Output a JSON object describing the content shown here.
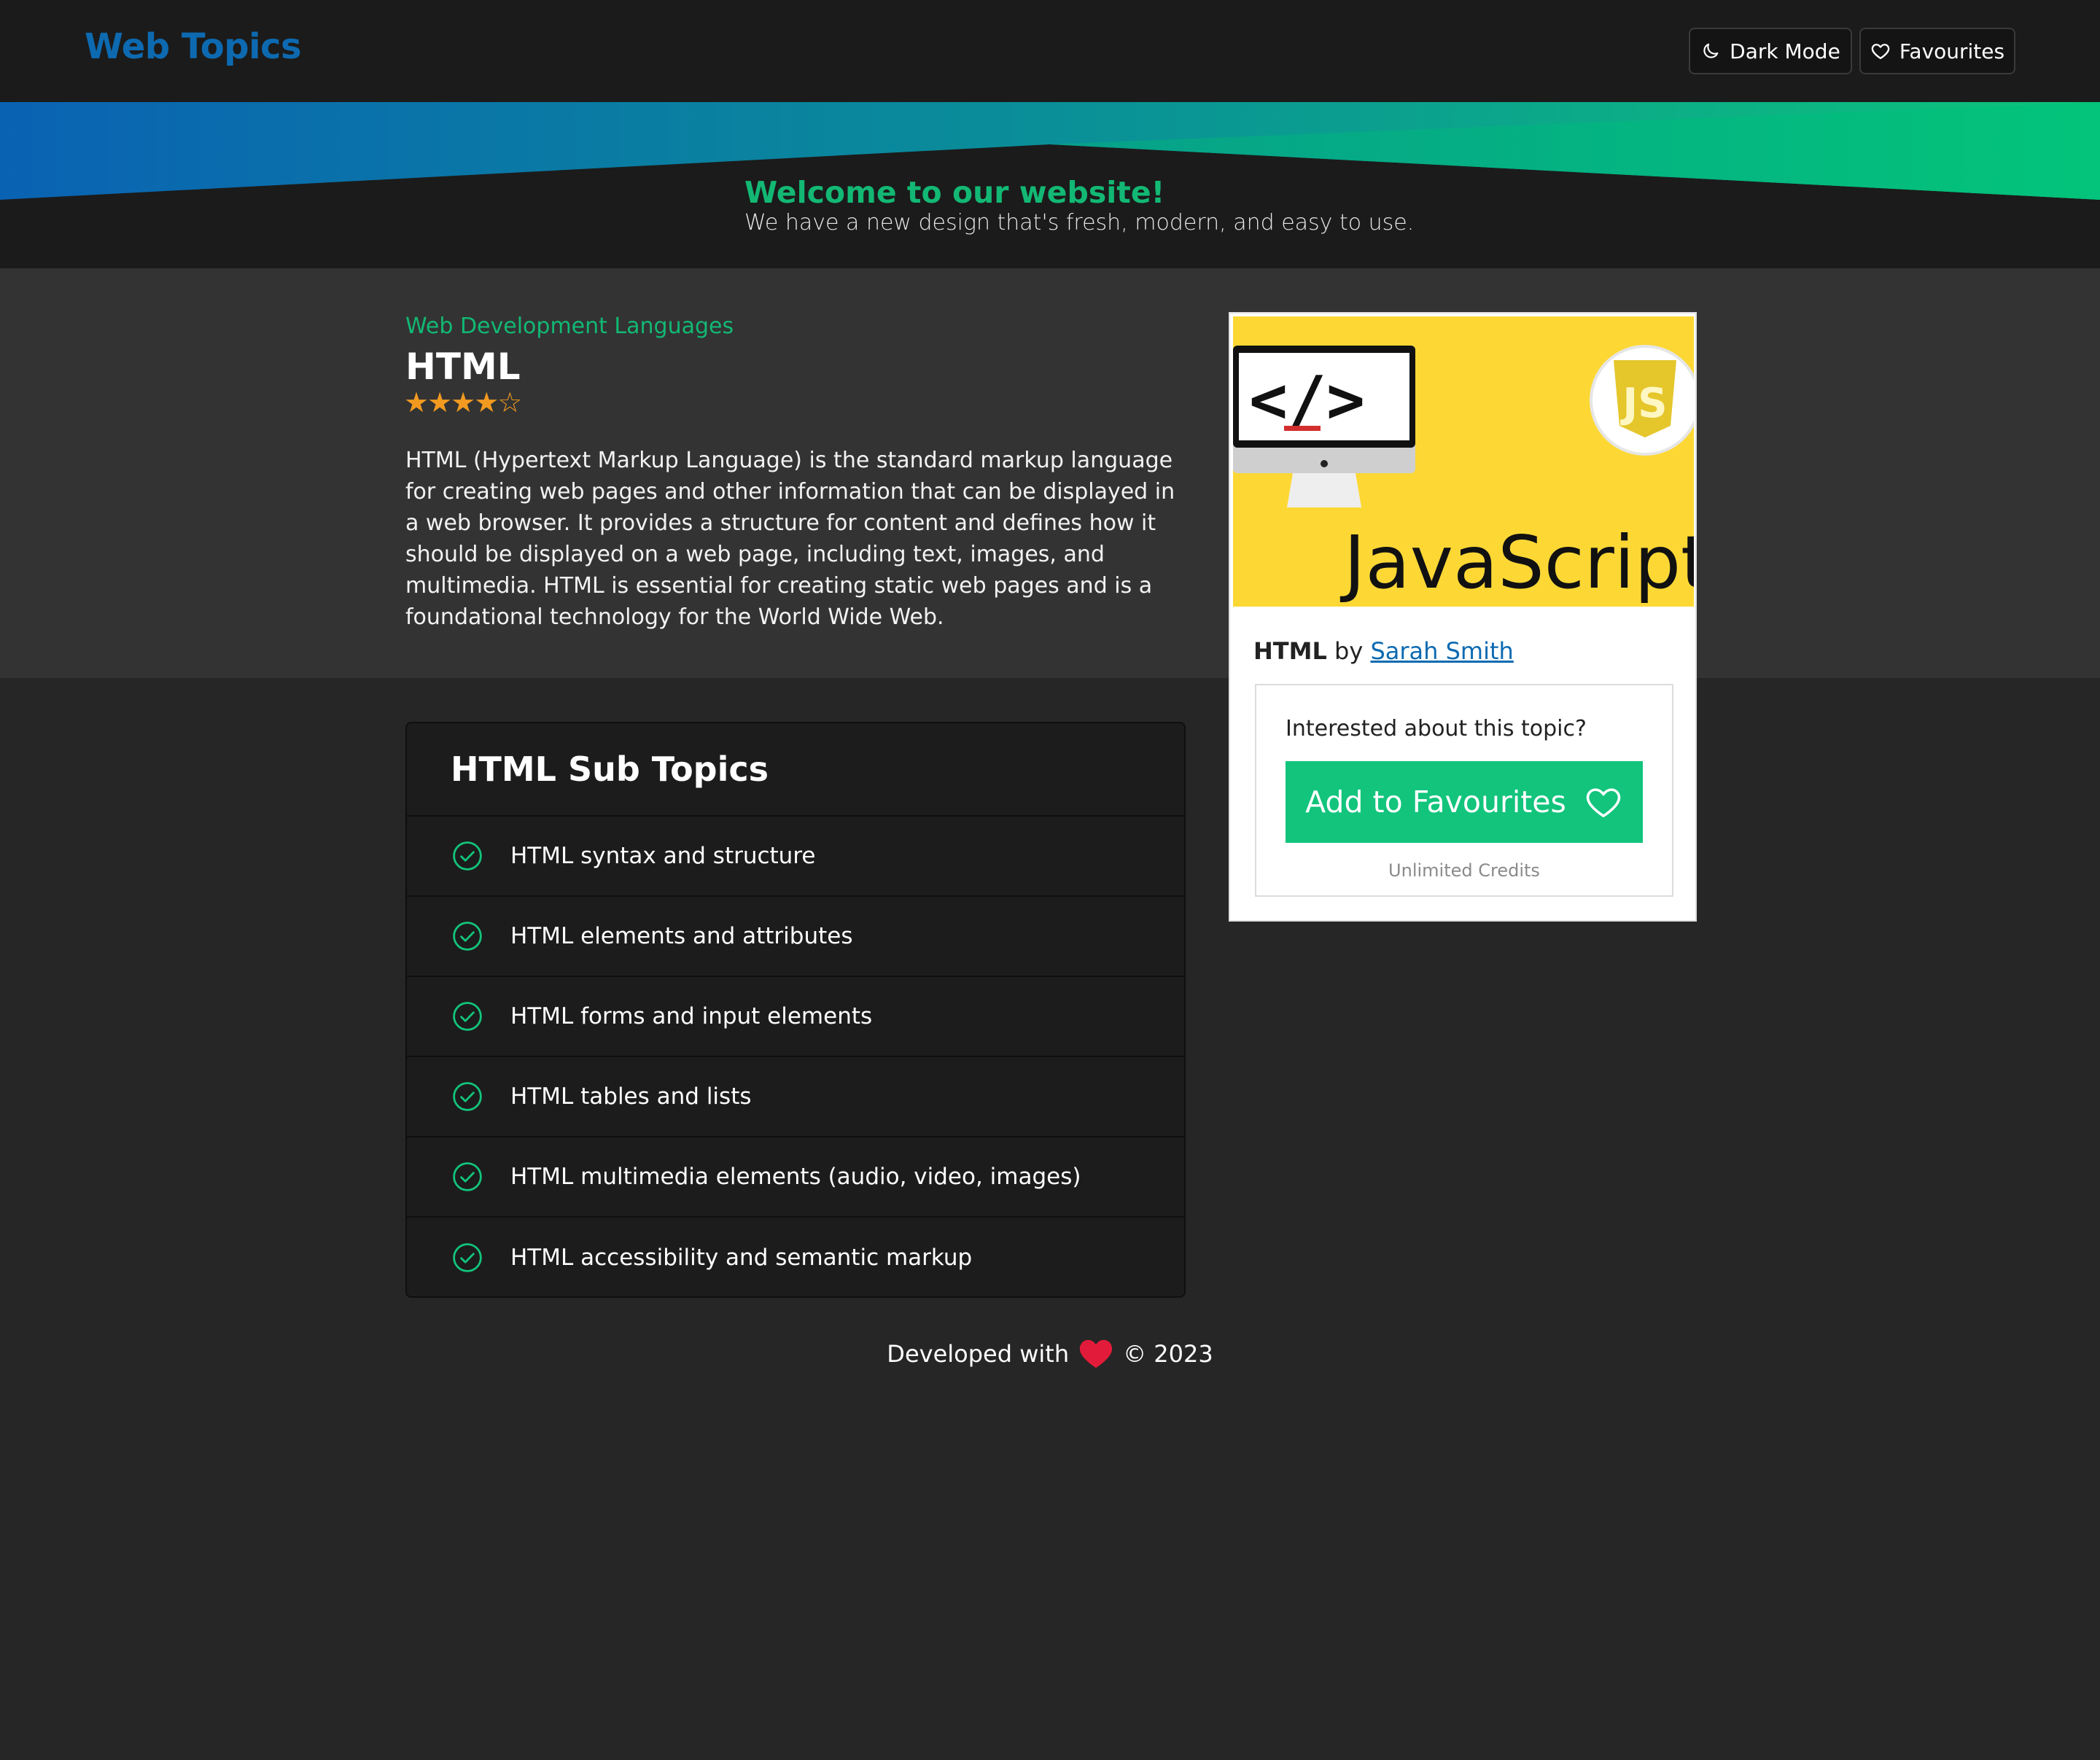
{
  "header": {
    "brand": "Web Topics",
    "dark_mode_label": "Dark Mode",
    "favourites_label": "Favourites"
  },
  "banner": {
    "title": "Welcome to our website!",
    "subtitle": "We have a new design that's fresh, modern, and easy to use."
  },
  "topic": {
    "category": "Web Development Languages",
    "title": "HTML",
    "rating": 4,
    "rating_max": 5,
    "stars_text": "★★★★☆",
    "description": "HTML (Hypertext Markup Language) is the standard markup language for creating web pages and other information that can be displayed in a web browser. It provides a structure for content and defines how it should be displayed on a web page, including text, images, and multimedia. HTML is essential for creating static web pages and is a foundational technology for the World Wide Web."
  },
  "card": {
    "image_text": "JavaScript",
    "image_badge": "JS",
    "image_code": "</>",
    "byline_topic": "HTML",
    "byline_by": "by",
    "author": "Sarah Smith",
    "question": "Interested about this topic?",
    "add_button": "Add to Favourites",
    "credits": "Unlimited Credits"
  },
  "subtopics": {
    "heading": "HTML Sub Topics",
    "items": [
      "HTML syntax and structure",
      "HTML elements and attributes",
      "HTML forms and input elements",
      "HTML tables and lists",
      "HTML multimedia elements (audio, video, images)",
      "HTML accessibility and semantic markup"
    ]
  },
  "footer": {
    "prefix": "Developed with",
    "suffix": "© 2023"
  },
  "colors": {
    "brand_blue": "#0d6ab1",
    "accent_green": "#12c47c",
    "star_orange": "#f29a20",
    "heart_red": "#e31b3a"
  },
  "icons": {
    "dark_mode": "moon-icon",
    "favourites": "heart-outline-icon",
    "subtopic_check": "check-circle-icon",
    "footer_heart": "heart-filled-icon"
  }
}
